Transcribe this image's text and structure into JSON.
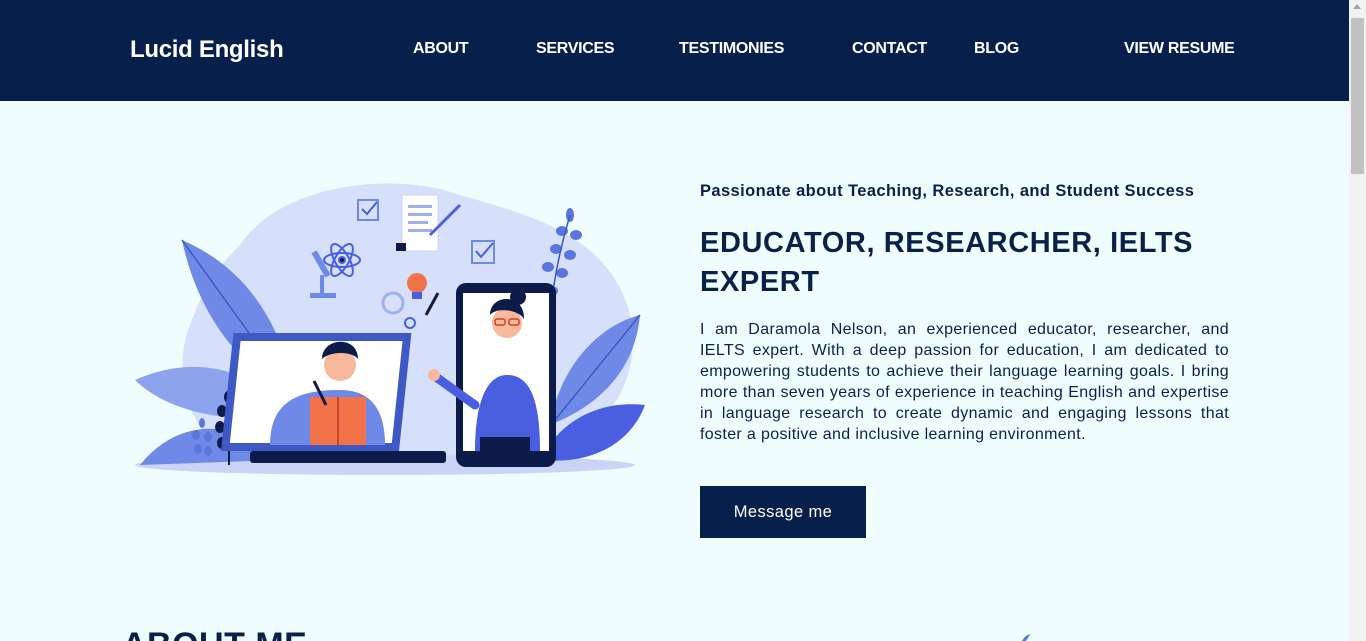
{
  "nav": {
    "brand": "Lucid English",
    "links": [
      "ABOUT",
      "SERVICES",
      "TESTIMONIES",
      "CONTACT",
      "BLOG"
    ],
    "resume": "VIEW RESUME"
  },
  "hero": {
    "tagline": "Passionate about Teaching, Research, and Student Success",
    "headline": "EDUCATOR, RESEARCHER, IELTS EXPERT",
    "bio": "I am Daramola Nelson, an experienced educator, researcher, and IELTS expert. With a deep passion for education, I am dedicated to empowering students to achieve their language learning goals. I bring more than seven years of experience in teaching English and expertise in language research to create dynamic and engaging lessons that foster a positive and inclusive learning environment.",
    "cta": "Message me"
  },
  "about": {
    "heading": "ABOUT ME"
  },
  "colors": {
    "navy": "#061f4b",
    "background": "#f0fdff",
    "accent_blue": "#4a5fe0",
    "light_blue": "#d7e0fb"
  }
}
